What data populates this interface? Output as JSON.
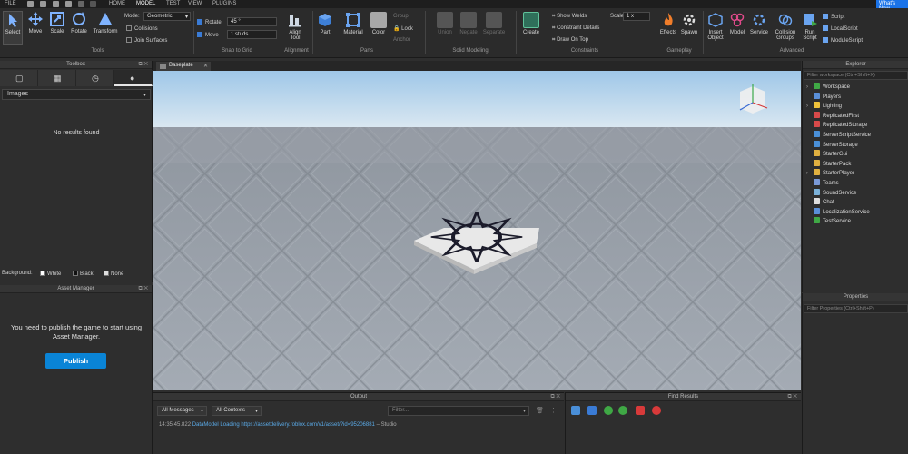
{
  "menubar": {
    "file": "FILE",
    "tabs": [
      "HOME",
      "MODEL",
      "TEST",
      "VIEW",
      "PLUGINS"
    ],
    "whats_new": "What's New"
  },
  "ribbon": {
    "tools": [
      "Select",
      "Move",
      "Scale",
      "Rotate",
      "Transform"
    ],
    "tools_group": "Tools",
    "mode_label": "Mode:",
    "mode_value": "Geometric",
    "collisions": "Collisions",
    "join_surfaces": "Join Surfaces",
    "rotate_label": "Rotate",
    "rotate_value": "45 °",
    "move_label": "Move",
    "move_value": "1 studs",
    "snap_group": "Snap to Grid",
    "align_tool": "Align Tool",
    "alignment_group": "Alignment",
    "part": "Part",
    "material": "Material",
    "color": "Color",
    "group_btn": "Group",
    "lock_btn": "Lock",
    "anchor_btn": "Anchor",
    "parts_group": "Parts",
    "union": "Union",
    "negate": "Negate",
    "separate": "Separate",
    "solid_group": "Solid Modeling",
    "create": "Create",
    "show_welds": "Show Welds",
    "constraint_details": "Constraint Details",
    "draw_on_top": "Draw On Top",
    "scale_label": "Scale",
    "scale_value": "1 x",
    "constraints_group": "Constraints",
    "effects": "Effects",
    "spawn": "Spawn",
    "gameplay_group": "Gameplay",
    "insert_object": "Insert Object",
    "model": "Model",
    "service": "Service",
    "collision_groups": "Collision Groups",
    "run_script": "Run Script",
    "script": "Script",
    "local_script": "LocalScript",
    "module_script": "ModuleScript",
    "advanced_group": "Advanced"
  },
  "toolbox": {
    "title": "Toolbox",
    "category": "Images",
    "empty": "No results found",
    "background_label": "Background:",
    "bg_options": [
      "White",
      "Black",
      "None"
    ]
  },
  "asset_manager": {
    "title": "Asset Manager",
    "message": "You need to publish the game to start using Asset Manager.",
    "publish": "Publish"
  },
  "viewport": {
    "tab": "Baseplate"
  },
  "explorer": {
    "title": "Explorer",
    "filter_placeholder": "Filter workspace (Ctrl+Shift+X)",
    "items": [
      {
        "label": "Workspace",
        "expandable": true,
        "color": "#3fa845"
      },
      {
        "label": "Players",
        "expandable": false,
        "color": "#5a8fd8"
      },
      {
        "label": "Lighting",
        "expandable": true,
        "color": "#f0c23a"
      },
      {
        "label": "ReplicatedFirst",
        "expandable": false,
        "color": "#d84a4a"
      },
      {
        "label": "ReplicatedStorage",
        "expandable": false,
        "color": "#d84a4a"
      },
      {
        "label": "ServerScriptService",
        "expandable": false,
        "color": "#4a90d8"
      },
      {
        "label": "ServerStorage",
        "expandable": false,
        "color": "#4a90d8"
      },
      {
        "label": "StarterGui",
        "expandable": false,
        "color": "#e0b040"
      },
      {
        "label": "StarterPack",
        "expandable": false,
        "color": "#e0b040"
      },
      {
        "label": "StarterPlayer",
        "expandable": true,
        "color": "#e0b040"
      },
      {
        "label": "Teams",
        "expandable": false,
        "color": "#7a9ad8"
      },
      {
        "label": "SoundService",
        "expandable": false,
        "color": "#7ab0d8"
      },
      {
        "label": "Chat",
        "expandable": false,
        "color": "#dddddd"
      },
      {
        "label": "LocalizationService",
        "expandable": false,
        "color": "#5a8fd8"
      },
      {
        "label": "TestService",
        "expandable": false,
        "color": "#3fa845"
      }
    ]
  },
  "properties": {
    "title": "Properties",
    "filter_placeholder": "Filter Properties (Ctrl+Shift+P)"
  },
  "output": {
    "title": "Output",
    "messages_dd": "All Messages",
    "contexts_dd": "All Contexts",
    "filter_placeholder": "Filter...",
    "log_time": "14:35:45.822",
    "log_text": "DataModel Loading https://assetdelivery.roblox.com/v1/asset/?id=95206881",
    "log_source": "– Studio"
  },
  "find_results": {
    "title": "Find Results"
  },
  "colors": {
    "accent": "#0a84d6",
    "panel": "#2e2e2e",
    "sky_top": "#b9d7ee",
    "baseplate": "#a9b0b8"
  }
}
